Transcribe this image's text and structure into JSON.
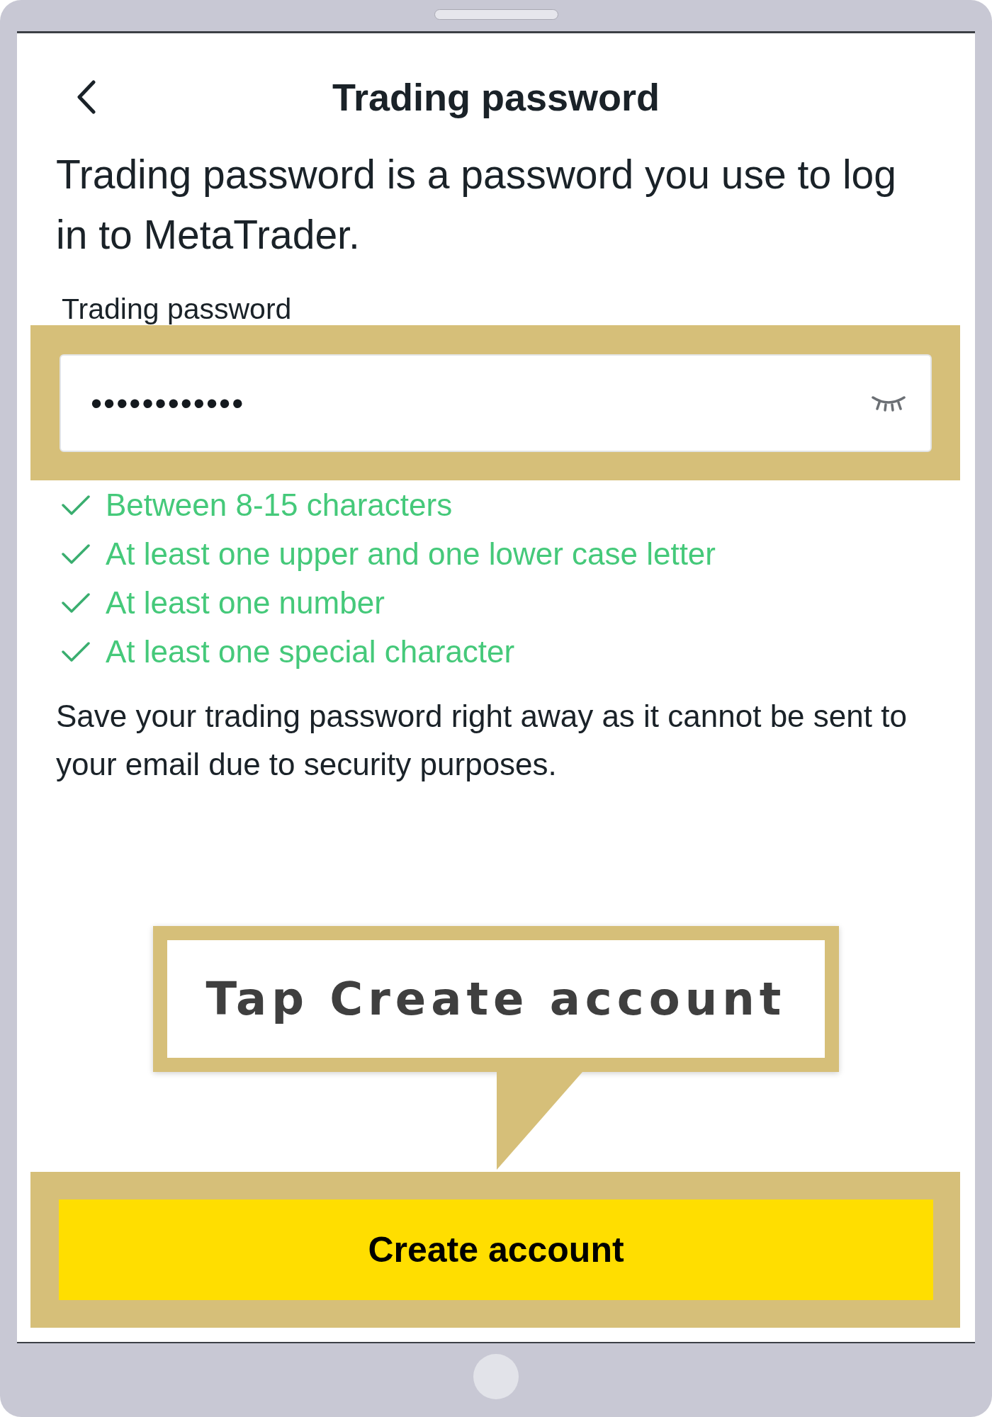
{
  "header": {
    "title": "Trading password"
  },
  "intro": "Trading password is a password you use to log in to MetaTrader.",
  "password_field": {
    "label": "Trading password",
    "value": "••••••••••••",
    "highlighted": true
  },
  "requirements": [
    {
      "text": "Between 8-15 characters",
      "met": true
    },
    {
      "text": "At least one upper and one lower case letter",
      "met": true
    },
    {
      "text": "At least one number",
      "met": true
    },
    {
      "text": "At least one special character",
      "met": true
    }
  ],
  "note": "Save your trading password right away as it cannot be sent to your email due to security purposes.",
  "callout": {
    "text": "Tap Create account"
  },
  "create_button": {
    "label": "Create account",
    "highlighted": true
  }
}
